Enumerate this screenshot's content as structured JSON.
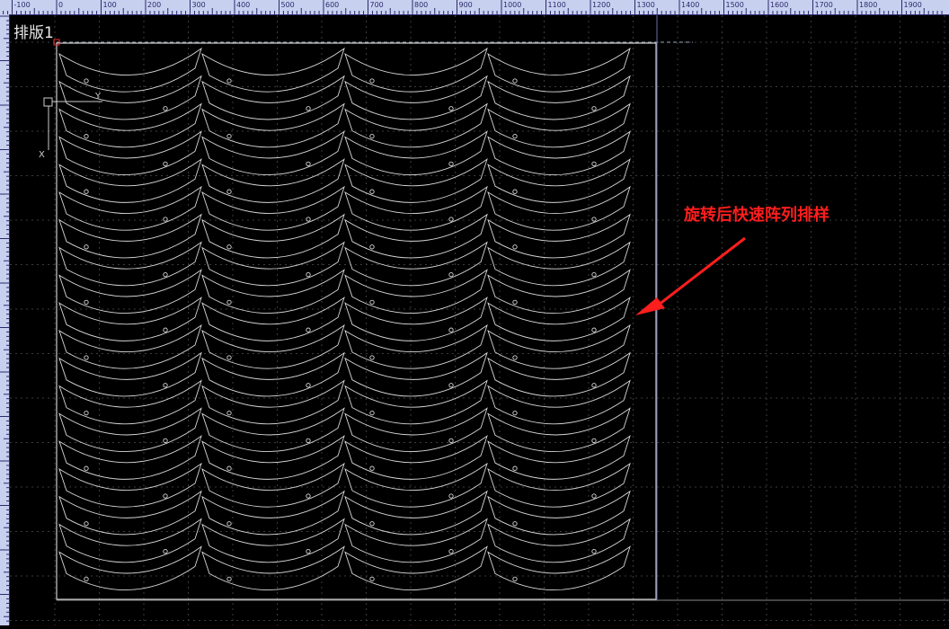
{
  "ruler": {
    "labels": [
      "-100",
      "0",
      "100",
      "200",
      "300",
      "400",
      "500",
      "600",
      "700",
      "800",
      "900",
      "1000",
      "1100",
      "1200",
      "1300",
      "1400",
      "1500",
      "1600",
      "1700",
      "1800",
      "1900"
    ],
    "label_start": -100,
    "label_step": 100
  },
  "sheet": {
    "title": "排版1"
  },
  "axes": {
    "y_label": "Y",
    "x_label": "X"
  },
  "annotation": {
    "text": "旋转后快速阵列排样",
    "color": "#ff1e1e"
  },
  "layout_pattern": {
    "columns": 4,
    "rows": 19
  },
  "colors": {
    "background": "#000000",
    "ruler": "#c8d0f0",
    "grid": "#3c3c3c",
    "parts": "#d8d8d8",
    "sheet_border": "#cfcfcf"
  }
}
